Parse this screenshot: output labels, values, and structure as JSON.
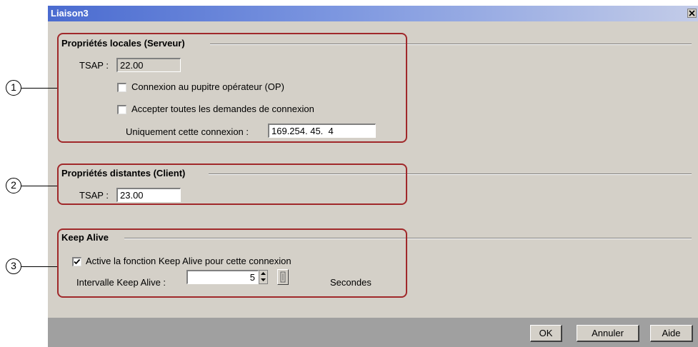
{
  "window": {
    "title": "Liaison3",
    "close_icon": "close-icon"
  },
  "local_properties": {
    "title": "Propriétés locales (Serveur)",
    "tsap_label": "TSAP :",
    "tsap_value": "22.00",
    "op_connection": {
      "label": "Connexion au pupitre opérateur (OP)",
      "checked": false
    },
    "accept_all": {
      "label": "Accepter toutes les demandes de connexion",
      "checked": false
    },
    "only_this_label": "Uniquement cette connexion :",
    "only_this_value": "169.254. 45.  4"
  },
  "remote_properties": {
    "title": "Propriétés distantes (Client)",
    "tsap_label": "TSAP :",
    "tsap_value": "23.00"
  },
  "keep_alive": {
    "title": "Keep Alive",
    "enable": {
      "label": "Active la fonction Keep Alive pour cette connexion",
      "checked": true
    },
    "interval_label": "Intervalle Keep Alive :",
    "interval_value": "5",
    "unit_label": "Secondes"
  },
  "footer": {
    "ok_label": "OK",
    "cancel_label": "Annuler",
    "help_label": "Aide"
  },
  "callouts": [
    "1",
    "2",
    "3"
  ],
  "colors": {
    "dialog_bg": "#d4d0c8",
    "titlebar_start": "#4a6bd0",
    "titlebar_end": "#c3cce8",
    "callout_border": "#a0282a",
    "footer_bg": "#a0a0a0"
  }
}
